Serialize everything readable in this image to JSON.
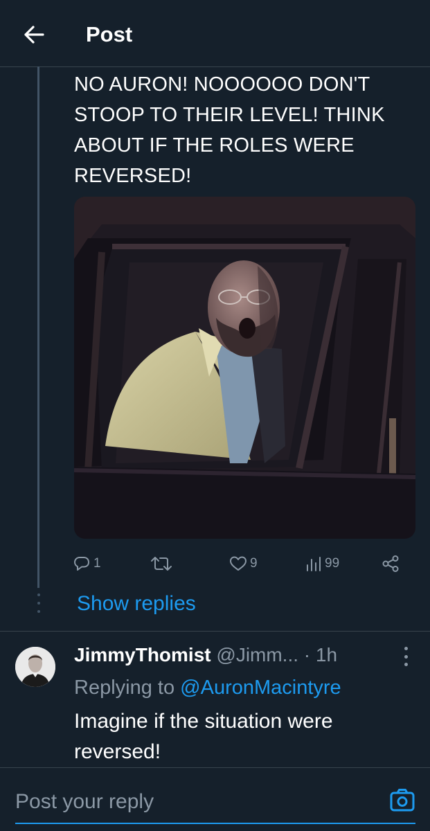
{
  "header": {
    "title": "Post",
    "back_icon": "arrow-left-icon"
  },
  "tweet": {
    "text": "NO AURON! NOOOOOO DON'T STOOP TO THEIR LEVEL! THINK ABOUT IF THE ROLES WERE REVERSED!",
    "media_alt": "man in tan jacket shouting from car window",
    "actions": {
      "replies": "1",
      "retweets": "",
      "likes": "9",
      "views": "99"
    },
    "show_replies_label": "Show replies"
  },
  "reply": {
    "name": "JimmyThomist",
    "handle_time": "@Jimm... · 1h",
    "replying_prefix": "Replying to ",
    "replying_to": "@AuronMacintyre",
    "text": "Imagine if the situation were reversed!"
  },
  "composer": {
    "placeholder": "Post your reply"
  },
  "colors": {
    "background": "#15202b",
    "accent": "#1d9bf0",
    "muted": "#8b98a5",
    "divider": "#38444d"
  }
}
